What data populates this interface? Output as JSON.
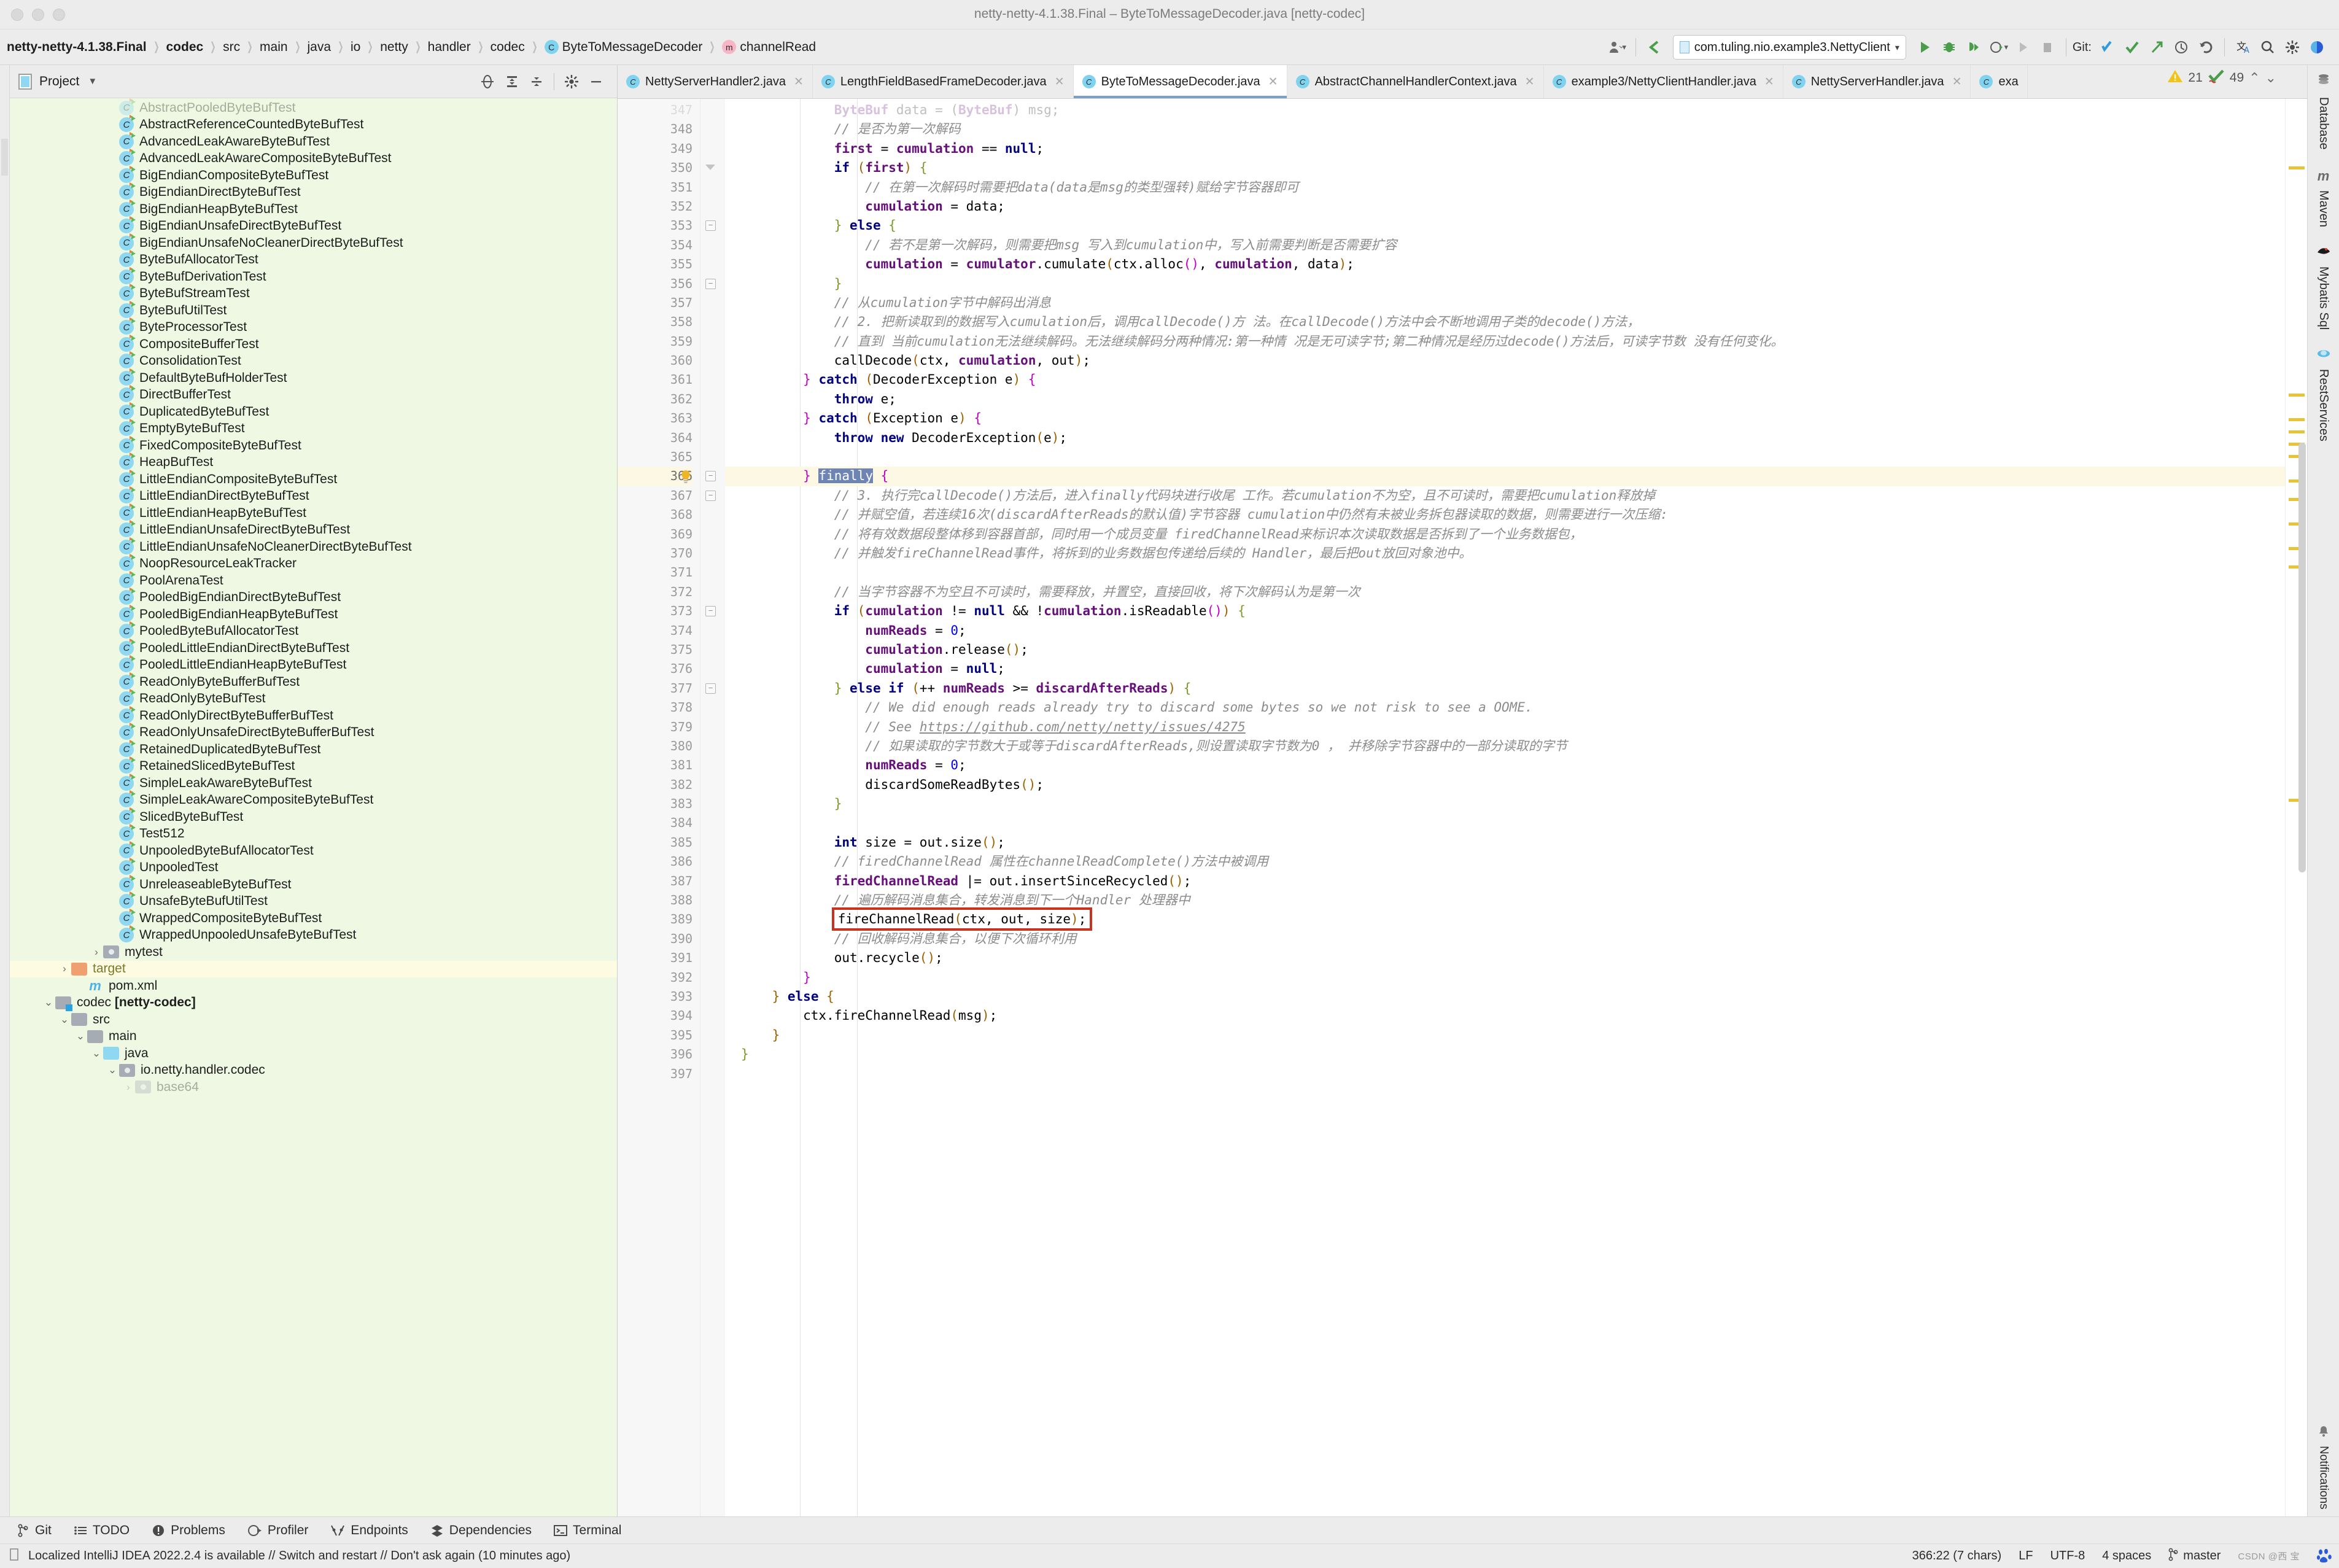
{
  "window": {
    "title": "netty-netty-4.1.38.Final – ByteToMessageDecoder.java [netty-codec]"
  },
  "breadcrumbs": [
    {
      "label": "netty-netty-4.1.38.Final",
      "icon": null,
      "bold": true
    },
    {
      "label": "codec",
      "icon": null,
      "bold": true
    },
    {
      "label": "src",
      "icon": null,
      "bold": false
    },
    {
      "label": "main",
      "icon": null,
      "bold": false
    },
    {
      "label": "java",
      "icon": null,
      "bold": false
    },
    {
      "label": "io",
      "icon": null,
      "bold": false
    },
    {
      "label": "netty",
      "icon": null,
      "bold": false
    },
    {
      "label": "handler",
      "icon": null,
      "bold": false
    },
    {
      "label": "codec",
      "icon": null,
      "bold": false
    },
    {
      "label": "ByteToMessageDecoder",
      "icon": "class-icon",
      "bold": false
    },
    {
      "label": "channelRead",
      "icon": "method-icon",
      "bold": false
    }
  ],
  "toolbar": {
    "run_config": "com.tuling.nio.example3.NettyClient",
    "git_label": "Git:",
    "icons": [
      "user-avatar-icon",
      "back-arrow-icon",
      "run-icon",
      "debug-icon",
      "run-with-coverage-icon",
      "profiler-icon",
      "run-disabled-icon",
      "stop-icon",
      "git-update-icon",
      "git-commit-icon",
      "git-push-icon",
      "git-history-icon",
      "git-rollback-icon",
      "translate-icon",
      "search-everywhere-icon",
      "settings-icon",
      "ide-theme-icon"
    ]
  },
  "project_panel": {
    "title": "Project",
    "icons": [
      "locate-icon",
      "expand-all-icon",
      "collapse-all-icon",
      "gear-icon",
      "minimize-icon"
    ],
    "tree": [
      {
        "label": "AbstractPooledByteBufTest",
        "indent": 6,
        "type": "class",
        "partial": true
      },
      {
        "label": "AbstractReferenceCountedByteBufTest",
        "indent": 6,
        "type": "class"
      },
      {
        "label": "AdvancedLeakAwareByteBufTest",
        "indent": 6,
        "type": "class"
      },
      {
        "label": "AdvancedLeakAwareCompositeByteBufTest",
        "indent": 6,
        "type": "class"
      },
      {
        "label": "BigEndianCompositeByteBufTest",
        "indent": 6,
        "type": "class"
      },
      {
        "label": "BigEndianDirectByteBufTest",
        "indent": 6,
        "type": "class"
      },
      {
        "label": "BigEndianHeapByteBufTest",
        "indent": 6,
        "type": "class"
      },
      {
        "label": "BigEndianUnsafeDirectByteBufTest",
        "indent": 6,
        "type": "class"
      },
      {
        "label": "BigEndianUnsafeNoCleanerDirectByteBufTest",
        "indent": 6,
        "type": "class"
      },
      {
        "label": "ByteBufAllocatorTest",
        "indent": 6,
        "type": "class"
      },
      {
        "label": "ByteBufDerivationTest",
        "indent": 6,
        "type": "class"
      },
      {
        "label": "ByteBufStreamTest",
        "indent": 6,
        "type": "class"
      },
      {
        "label": "ByteBufUtilTest",
        "indent": 6,
        "type": "class"
      },
      {
        "label": "ByteProcessorTest",
        "indent": 6,
        "type": "class"
      },
      {
        "label": "CompositeBufferTest",
        "indent": 6,
        "type": "class"
      },
      {
        "label": "ConsolidationTest",
        "indent": 6,
        "type": "class"
      },
      {
        "label": "DefaultByteBufHolderTest",
        "indent": 6,
        "type": "class"
      },
      {
        "label": "DirectBufferTest",
        "indent": 6,
        "type": "class"
      },
      {
        "label": "DuplicatedByteBufTest",
        "indent": 6,
        "type": "class"
      },
      {
        "label": "EmptyByteBufTest",
        "indent": 6,
        "type": "class"
      },
      {
        "label": "FixedCompositeByteBufTest",
        "indent": 6,
        "type": "class"
      },
      {
        "label": "HeapBufTest",
        "indent": 6,
        "type": "class"
      },
      {
        "label": "LittleEndianCompositeByteBufTest",
        "indent": 6,
        "type": "class"
      },
      {
        "label": "LittleEndianDirectByteBufTest",
        "indent": 6,
        "type": "class"
      },
      {
        "label": "LittleEndianHeapByteBufTest",
        "indent": 6,
        "type": "class"
      },
      {
        "label": "LittleEndianUnsafeDirectByteBufTest",
        "indent": 6,
        "type": "class"
      },
      {
        "label": "LittleEndianUnsafeNoCleanerDirectByteBufTest",
        "indent": 6,
        "type": "class"
      },
      {
        "label": "NoopResourceLeakTracker",
        "indent": 6,
        "type": "class"
      },
      {
        "label": "PoolArenaTest",
        "indent": 6,
        "type": "class"
      },
      {
        "label": "PooledBigEndianDirectByteBufTest",
        "indent": 6,
        "type": "class"
      },
      {
        "label": "PooledBigEndianHeapByteBufTest",
        "indent": 6,
        "type": "class"
      },
      {
        "label": "PooledByteBufAllocatorTest",
        "indent": 6,
        "type": "class"
      },
      {
        "label": "PooledLittleEndianDirectByteBufTest",
        "indent": 6,
        "type": "class"
      },
      {
        "label": "PooledLittleEndianHeapByteBufTest",
        "indent": 6,
        "type": "class"
      },
      {
        "label": "ReadOnlyByteBufferBufTest",
        "indent": 6,
        "type": "class"
      },
      {
        "label": "ReadOnlyByteBufTest",
        "indent": 6,
        "type": "class"
      },
      {
        "label": "ReadOnlyDirectByteBufferBufTest",
        "indent": 6,
        "type": "class"
      },
      {
        "label": "ReadOnlyUnsafeDirectByteBufferBufTest",
        "indent": 6,
        "type": "class"
      },
      {
        "label": "RetainedDuplicatedByteBufTest",
        "indent": 6,
        "type": "class"
      },
      {
        "label": "RetainedSlicedByteBufTest",
        "indent": 6,
        "type": "class"
      },
      {
        "label": "SimpleLeakAwareByteBufTest",
        "indent": 6,
        "type": "class"
      },
      {
        "label": "SimpleLeakAwareCompositeByteBufTest",
        "indent": 6,
        "type": "class"
      },
      {
        "label": "SlicedByteBufTest",
        "indent": 6,
        "type": "class"
      },
      {
        "label": "Test512",
        "indent": 6,
        "type": "class"
      },
      {
        "label": "UnpooledByteBufAllocatorTest",
        "indent": 6,
        "type": "class"
      },
      {
        "label": "UnpooledTest",
        "indent": 6,
        "type": "class"
      },
      {
        "label": "UnreleaseableByteBufTest",
        "indent": 6,
        "type": "class"
      },
      {
        "label": "UnsafeByteBufUtilTest",
        "indent": 6,
        "type": "class"
      },
      {
        "label": "WrappedCompositeByteBufTest",
        "indent": 6,
        "type": "class"
      },
      {
        "label": "WrappedUnpooledUnsafeByteBufTest",
        "indent": 6,
        "type": "class"
      },
      {
        "label": "mytest",
        "indent": 5,
        "type": "package",
        "chevron": "right"
      },
      {
        "label": "target",
        "indent": 3,
        "type": "folder-orange",
        "chevron": "right",
        "highlight": true
      },
      {
        "label": "pom.xml",
        "indent": 4,
        "type": "maven"
      },
      {
        "label": "codec [netty-codec]",
        "indent": 2,
        "type": "module",
        "chevron": "down",
        "bold_part": "[netty-codec]"
      },
      {
        "label": "src",
        "indent": 3,
        "type": "folder",
        "chevron": "down"
      },
      {
        "label": "main",
        "indent": 4,
        "type": "folder",
        "chevron": "down"
      },
      {
        "label": "java",
        "indent": 5,
        "type": "folder-blue",
        "chevron": "down"
      },
      {
        "label": "io.netty.handler.codec",
        "indent": 6,
        "type": "package",
        "chevron": "down"
      },
      {
        "label": "base64",
        "indent": 7,
        "type": "package",
        "chevron": "right",
        "partial": true
      }
    ]
  },
  "editor_tabs": [
    {
      "label": "NettyServerHandler2.java",
      "active": false
    },
    {
      "label": "LengthFieldBasedFrameDecoder.java",
      "active": false
    },
    {
      "label": "ByteToMessageDecoder.java",
      "active": true
    },
    {
      "label": "AbstractChannelHandlerContext.java",
      "active": false
    },
    {
      "label": "example3/NettyClientHandler.java",
      "active": false
    },
    {
      "label": "NettyServerHandler.java",
      "active": false
    },
    {
      "label": "exa",
      "active": false
    }
  ],
  "inspection": {
    "warnings": "21",
    "checks": "49"
  },
  "code": {
    "first_line": 347,
    "current_line": 366,
    "lines": [
      {
        "n": 347,
        "html": "            <span class=\"fld\">ByteBuf</span> data = (<span class=\"fld\">ByteBuf</span>) msg;",
        "partial": true
      },
      {
        "n": 348,
        "html": "            <span class=\"cm\">// 是否为第一次解码</span>"
      },
      {
        "n": 349,
        "html": "            <span class=\"fld\">first</span> = <span class=\"fld\">cumulation</span> == <span class=\"kw\">null</span>;"
      },
      {
        "n": 350,
        "html": "            <span class=\"kw\">if</span> <span class=\"br1\">(</span><span class=\"fld\">first</span><span class=\"br1\">)</span> <span class=\"br3\">{</span>",
        "fold": "tri"
      },
      {
        "n": 351,
        "html": "                <span class=\"cm\">// 在第一次解码时需要把data(data是msg的类型强转)赋给字节容器即可</span>"
      },
      {
        "n": 352,
        "html": "                <span class=\"fld\">cumulation</span> = data;"
      },
      {
        "n": 353,
        "html": "            <span class=\"br3\">}</span> <span class=\"kw\">else</span> <span class=\"br3\">{</span>",
        "fold": "minus"
      },
      {
        "n": 354,
        "html": "                <span class=\"cm\">// 若不是第一次解码，则需要把msg 写入到cumulation中，写入前需要判断是否需要扩容</span>"
      },
      {
        "n": 355,
        "html": "                <span class=\"fld\">cumulation</span> = <span class=\"fld\">cumulator</span>.cumulate<span class=\"br1\">(</span>ctx.alloc<span class=\"br2\">()</span>, <span class=\"fld\">cumulation</span>, data<span class=\"br1\">)</span>;"
      },
      {
        "n": 356,
        "html": "            <span class=\"br3\">}</span>",
        "fold": "minus"
      },
      {
        "n": 357,
        "html": "            <span class=\"cm\">// 从cumulation字节中解码出消息</span>"
      },
      {
        "n": 358,
        "html": "            <span class=\"cm\">// 2. 把新读取到的数据写入cumulation后，调用callDecode()方 法。在callDecode()方法中会不断地调用子类的decode()方法，</span>"
      },
      {
        "n": 359,
        "html": "            <span class=\"cm\">// 直到 当前cumulation无法继续解码。无法继续解码分两种情况:第一种情 况是无可读字节;第二种情况是经历过decode()方法后，可读字节数 没有任何变化。</span>"
      },
      {
        "n": 360,
        "html": "            callDecode<span class=\"br1\">(</span>ctx, <span class=\"fld\">cumulation</span>, out<span class=\"br1\">)</span>;"
      },
      {
        "n": 361,
        "html": "        <span class=\"br2\">}</span> <span class=\"kw\">catch</span> <span class=\"br1\">(</span>DecoderException e<span class=\"br1\">)</span> <span class=\"br2\">{</span>"
      },
      {
        "n": 362,
        "html": "            <span class=\"kw\">throw</span> e;"
      },
      {
        "n": 363,
        "html": "        <span class=\"br2\">}</span> <span class=\"kw\">catch</span> <span class=\"br1\">(</span>Exception e<span class=\"br1\">)</span> <span class=\"br2\">{</span>"
      },
      {
        "n": 364,
        "html": "            <span class=\"kw\">throw new</span> DecoderException<span class=\"br1\">(</span>e<span class=\"br1\">)</span>;"
      },
      {
        "n": 365,
        "html": ""
      },
      {
        "n": 366,
        "html": "        <span class=\"br2\">}</span> <span class=\"sel\">finally</span> <span class=\"br2\">{</span>",
        "current": true,
        "fold": "minus",
        "bulb": true
      },
      {
        "n": 367,
        "html": "            <span class=\"cm\">// 3. 执行完callDecode()方法后，进入finally代码块进行收尾 工作。若cumulation不为空，且不可读时，需要把cumulation释放掉</span>",
        "fold": "minus"
      },
      {
        "n": 368,
        "html": "            <span class=\"cm\">// 并赋空值，若连续16次(discardAfterReads的默认值)字节容器 cumulation中仍然有未被业务拆包器读取的数据，则需要进行一次压缩:</span>"
      },
      {
        "n": 369,
        "html": "            <span class=\"cm\">// 将有效数据段整体移到容器首部，同时用一个成员变量 firedChannelRead来标识本次读取数据是否拆到了一个业务数据包，</span>"
      },
      {
        "n": 370,
        "html": "            <span class=\"cm\">// 并触发fireChannelRead事件，将拆到的业务数据包传递给后续的 Handler，最后把out放回对象池中。</span>"
      },
      {
        "n": 371,
        "html": ""
      },
      {
        "n": 372,
        "html": "            <span class=\"cm\">// 当字节容器不为空且不可读时，需要释放，并置空，直接回收，将下次解码认为是第一次</span>"
      },
      {
        "n": 373,
        "html": "            <span class=\"kw\">if</span> <span class=\"br1\">(</span><span class=\"fld\">cumulation</span> != <span class=\"kw\">null</span> &amp;&amp; !<span class=\"fld\">cumulation</span>.isReadable<span class=\"br2\">()</span><span class=\"br1\">)</span> <span class=\"br3\">{</span>",
        "fold": "minus"
      },
      {
        "n": 374,
        "html": "                <span class=\"fld\">numReads</span> = <span class=\"num\">0</span>;"
      },
      {
        "n": 375,
        "html": "                <span class=\"fld\">cumulation</span>.release<span class=\"br1\">()</span>;"
      },
      {
        "n": 376,
        "html": "                <span class=\"fld\">cumulation</span> = <span class=\"kw\">null</span>;"
      },
      {
        "n": 377,
        "html": "            <span class=\"br3\">}</span> <span class=\"kw\">else if</span> <span class=\"br1\">(</span>++ <span class=\"fld\">numReads</span> &gt;= <span class=\"fld\">discardAfterReads</span><span class=\"br1\">)</span> <span class=\"br3\">{</span>",
        "fold": "minus"
      },
      {
        "n": 378,
        "html": "                <span class=\"cm\">// We did enough reads already try to discard some bytes so we not risk to see a OOME.</span>"
      },
      {
        "n": 379,
        "html": "                <span class=\"cm\">// See </span><span class=\"lnk\">https://github.com/netty/netty/issues/4275</span>"
      },
      {
        "n": 380,
        "html": "                <span class=\"cm\">// 如果读取的字节数大于或等于discardAfterReads,则设置读取字节数为0 ， 并移除字节容器中的一部分读取的字节</span>"
      },
      {
        "n": 381,
        "html": "                <span class=\"fld\">numReads</span> = <span class=\"num\">0</span>;"
      },
      {
        "n": 382,
        "html": "                discardSomeReadBytes<span class=\"br1\">()</span>;"
      },
      {
        "n": 383,
        "html": "            <span class=\"br3\">}</span>"
      },
      {
        "n": 384,
        "html": ""
      },
      {
        "n": 385,
        "html": "            <span class=\"kw\">int</span> size = out.size<span class=\"br1\">()</span>;"
      },
      {
        "n": 386,
        "html": "            <span class=\"cm\">// firedChannelRead 属性在channelReadComplete()方法中被调用</span>"
      },
      {
        "n": 387,
        "html": "            <span class=\"fld\">firedChannelRead</span> |= out.insertSinceRecycled<span class=\"br1\">()</span>;"
      },
      {
        "n": 388,
        "html": "            <span class=\"cm\">// 遍历解码消息集合，转发消息到下一个Handler 处理器中</span>"
      },
      {
        "n": 389,
        "html": "            fireChannelRead<span class=\"br1\">(</span>ctx, out, size<span class=\"br1\">)</span>;",
        "boxed": true
      },
      {
        "n": 390,
        "html": "            <span class=\"cm\">// 回收解码消息集合，以便下次循环利用</span>"
      },
      {
        "n": 391,
        "html": "            out.recycle<span class=\"br1\">()</span>;"
      },
      {
        "n": 392,
        "html": "        <span class=\"br2\">}</span>"
      },
      {
        "n": 393,
        "html": "    <span class=\"br1\">}</span> <span class=\"kw\">else</span> <span class=\"br1\">{</span>"
      },
      {
        "n": 394,
        "html": "        ctx.fireChannelRead<span class=\"br1\">(</span>msg<span class=\"br1\">)</span>;"
      },
      {
        "n": 395,
        "html": "    <span class=\"br1\">}</span>"
      },
      {
        "n": 396,
        "html": "<span class=\"br3\">}</span>"
      },
      {
        "n": 397,
        "html": ""
      }
    ]
  },
  "right_rail": {
    "tools": [
      {
        "label": "Database",
        "icon": "database-icon"
      },
      {
        "label": "Maven",
        "icon": "maven-icon"
      },
      {
        "label": "Mybatis Sql",
        "icon": "mybatis-icon"
      },
      {
        "label": "RestServices",
        "icon": "restservices-icon"
      }
    ],
    "bottom": {
      "label": "Notifications",
      "icon": "bell-icon"
    }
  },
  "bottom_toolwindows": [
    {
      "label": "Git",
      "icon": "git-branch-icon"
    },
    {
      "label": "TODO",
      "icon": "todo-list-icon"
    },
    {
      "label": "Problems",
      "icon": "problems-icon"
    },
    {
      "label": "Profiler",
      "icon": "profiler-icon"
    },
    {
      "label": "Endpoints",
      "icon": "endpoints-icon"
    },
    {
      "label": "Dependencies",
      "icon": "dependencies-icon"
    },
    {
      "label": "Terminal",
      "icon": "terminal-icon"
    }
  ],
  "status_bar": {
    "message": "Localized IntelliJ IDEA 2022.2.4 is available // Switch and restart // Don't ask again (10 minutes ago)",
    "position": "366:22 (7 chars)",
    "line_separator": "LF",
    "encoding": "UTF-8",
    "indent": "4 spaces",
    "branch": "master",
    "watermark": "CSDN @西 宝"
  },
  "colors": {
    "accent_blue": "#7fd3ef",
    "selection": "#6d84b4",
    "highlight_box": "#c7331f",
    "tree_bg": "#eef8e2",
    "current_line": "#fdf8e3"
  }
}
